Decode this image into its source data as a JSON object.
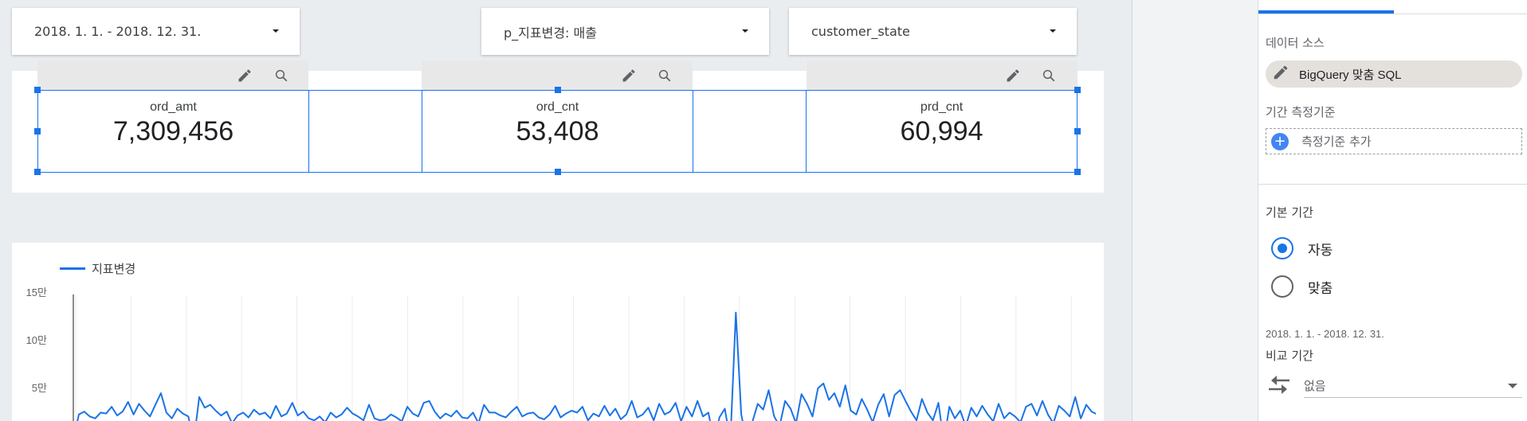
{
  "filters": {
    "date_range": "2018. 1. 1. - 2018. 12. 31.",
    "metric_param": "p_지표변경: 매출",
    "dimension": "customer_state"
  },
  "scorecards": [
    {
      "label": "ord_amt",
      "value": "7,309,456"
    },
    {
      "label": "ord_cnt",
      "value": "53,408"
    },
    {
      "label": "prd_cnt",
      "value": "60,994"
    }
  ],
  "chart": {
    "legend": "지표변경",
    "yticks": [
      "15만",
      "10만",
      "5만"
    ]
  },
  "chart_data": {
    "type": "line",
    "series": [
      {
        "name": "지표변경",
        "color": "#1a73e8",
        "values": [
          0,
          2.8,
          3.1,
          2.6,
          2.4,
          3.0,
          2.9,
          3.6,
          2.7,
          3.1,
          4.1,
          2.8,
          3.9,
          3.2,
          2.6,
          3.8,
          5.0,
          3.0,
          2.4,
          3.4,
          2.9,
          2.6,
          0,
          4.6,
          3.5,
          3.8,
          3.2,
          2.7,
          3.1,
          1.9,
          2.7,
          3.0,
          2.5,
          3.3,
          2.8,
          3.0,
          2.4,
          3.7,
          2.6,
          2.9,
          4.0,
          2.7,
          3.1,
          2.4,
          2.2,
          2.6,
          2.0,
          3.0,
          2.5,
          2.8,
          3.5,
          2.9,
          2.6,
          2.2,
          3.8,
          2.4,
          2.2,
          2.3,
          2.8,
          2.5,
          2.1,
          3.6,
          2.9,
          2.6,
          4.0,
          4.2,
          3.1,
          2.4,
          2.9,
          2.6,
          3.2,
          2.5,
          2.4,
          3.0,
          1.9,
          3.8,
          3.0,
          3.0,
          2.7,
          2.5,
          3.1,
          3.6,
          2.6,
          2.9,
          3.0,
          2.5,
          2.3,
          2.8,
          3.7,
          2.5,
          2.9,
          3.2,
          3.0,
          3.6,
          2.2,
          2.9,
          2.6,
          3.7,
          2.7,
          3.4,
          2.3,
          2.8,
          4.2,
          2.5,
          2.8,
          3.5,
          2.2,
          3.9,
          2.8,
          3.1,
          4.0,
          2.1,
          3.6,
          2.6,
          4.2,
          2.6,
          3.0,
          0,
          2.5,
          3.4,
          0,
          13.3,
          2.8,
          0,
          2.0,
          3.9,
          3.3,
          5.3,
          2.6,
          1.6,
          4.2,
          3.4,
          1.9,
          4.9,
          3.9,
          2.6,
          5.5,
          6.0,
          4.3,
          5.0,
          3.6,
          5.8,
          3.2,
          2.8,
          4.4,
          3.3,
          2.0,
          3.8,
          4.9,
          2.6,
          4.8,
          5.3,
          4.2,
          3.1,
          2.2,
          4.4,
          3.0,
          2.2,
          4.0,
          0,
          3.6,
          2.4,
          3.2,
          1.6,
          3.5,
          2.6,
          3.7,
          2.8,
          2.1,
          3.9,
          2.4,
          3.0,
          2.6,
          2.0,
          3.6,
          3.9,
          2.7,
          4.2,
          2.8,
          1.9,
          3.7,
          3.2,
          2.6,
          4.6,
          2.4,
          3.8,
          3.1,
          2.8,
          3.5,
          2.2,
          2.0,
          3.6,
          4.5,
          3.2,
          2.4,
          4.7,
          2.8,
          2.3,
          3.1,
          3.8,
          2.8,
          3.1,
          2.4,
          1.8,
          2.7,
          3.4,
          2.5,
          1.9,
          3.8,
          2.7,
          2.0,
          2.8,
          9.2,
          2.0,
          0,
          1.6,
          2.6,
          1.1,
          2.2,
          2.3,
          1.8,
          3.0,
          2.5,
          1.6,
          2.2,
          2.7,
          1.9,
          3.4,
          3.9,
          3.4,
          1.6,
          2.9,
          4.7,
          3.8,
          3.0,
          2.0,
          4.2,
          2.6,
          2.0,
          1.5,
          5.6,
          3.8,
          2.8,
          4.6,
          3.5,
          1.4,
          2.9,
          3.4,
          4.2,
          4.8,
          2.9,
          4.2,
          3.2,
          3.8,
          4.5,
          4.0,
          3.2,
          4.6,
          5.2,
          4.3,
          3.8,
          3.2,
          3.0,
          3.6,
          2.2,
          3.2,
          3.9,
          3.3,
          1.4,
          5.6,
          2.2,
          1.4,
          1.0,
          0.3
        ]
      }
    ],
    "y_unit": "만",
    "ylim": [
      0,
      15
    ],
    "grid": true,
    "legend": "top-left"
  },
  "panel": {
    "data_source_title": "데이터 소스",
    "data_source_name": "BigQuery 맞춤 SQL",
    "date_dimension_title": "기간 측정기준",
    "add_dimension_label": "측정기준 추가",
    "default_range_title": "기본 기간",
    "radio_auto": "자동",
    "radio_custom": "맞춤",
    "range_text": "2018. 1. 1. - 2018. 12. 31.",
    "compare_title": "비교 기간",
    "compare_value": "없음"
  }
}
